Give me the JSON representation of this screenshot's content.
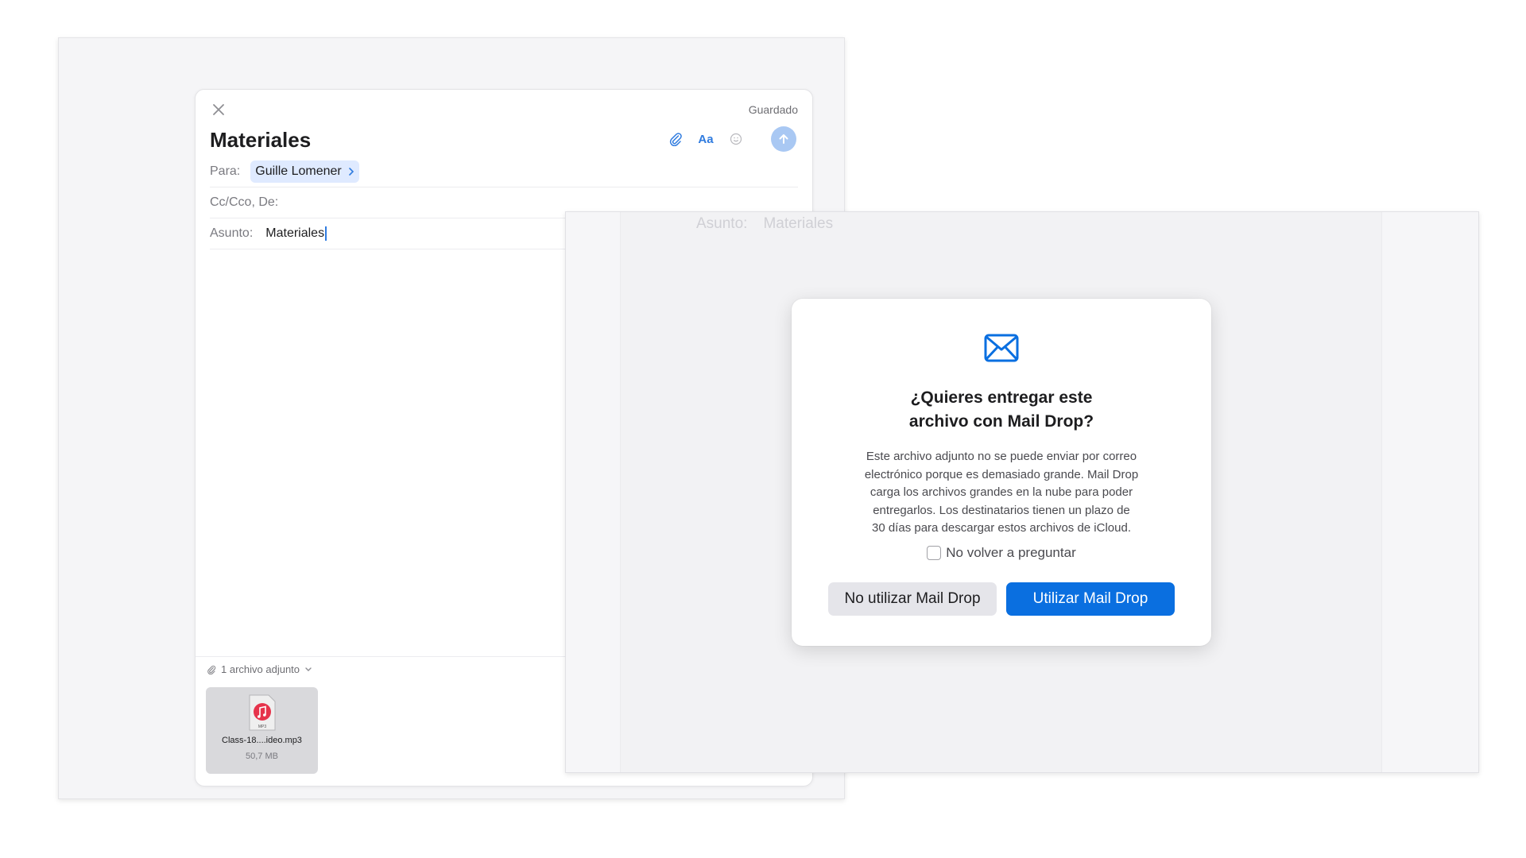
{
  "compose": {
    "status": "Guardado",
    "title": "Materiales",
    "toolbar": {
      "attach_icon": "paperclip-icon",
      "format_label": "Aa",
      "emoji_icon": "smiley-icon",
      "send_icon": "arrow-up-icon"
    },
    "to_label": "Para:",
    "to_recipient": "Guille Lomener",
    "cc_label": "Cc/Cco, De:",
    "subject_label": "Asunto:",
    "subject_value": "Materiales",
    "attachments_label": "1 archivo adjunto",
    "attachment": {
      "name": "Class-18....ideo.mp3",
      "size": "50,7 MB",
      "type_badge": "MP3"
    }
  },
  "background_window": {
    "subject_label": "Asunto:",
    "subject_value": "Materiales"
  },
  "dialog": {
    "icon": "envelope-icon",
    "title_line1": "¿Quieres entregar este",
    "title_line2": "archivo con Mail Drop?",
    "body_lines": [
      "Este archivo adjunto no se puede enviar por correo",
      "electrónico porque es demasiado grande. Mail Drop",
      "carga los archivos grandes en la nube para poder",
      "entregarlos. Los destinatarios tienen un plazo de",
      "30 días para descargar estos archivos de iCloud."
    ],
    "checkbox_label": "No volver a preguntar",
    "checkbox_checked": false,
    "secondary_button": "No utilizar Mail Drop",
    "primary_button": "Utilizar Mail Drop"
  },
  "colors": {
    "accent": "#0a6fe0",
    "chip_bg": "#dfeaff",
    "send_disabled": "#a9c8f3"
  }
}
